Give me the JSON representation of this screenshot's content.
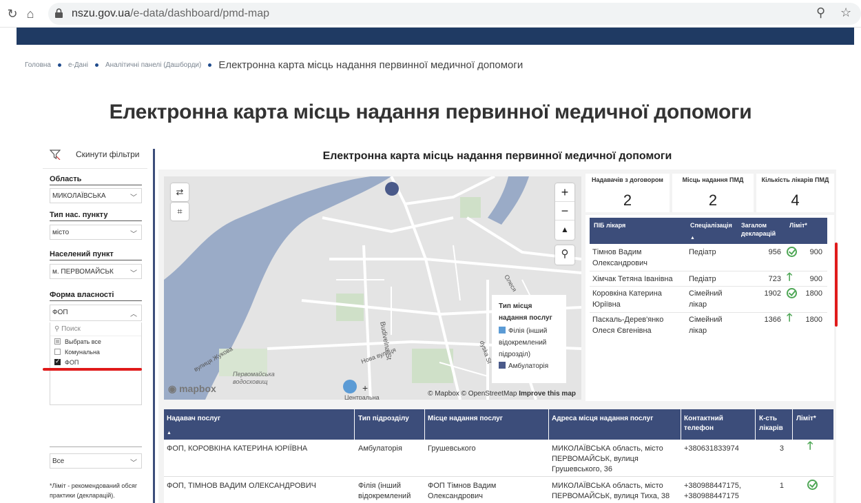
{
  "browser": {
    "url_host": "nszu.gov.ua",
    "url_path": "/e-data/dashboard/pmd-map"
  },
  "breadcrumb": [
    "Головна",
    "е-Дані",
    "Аналітичні панелі (Дашборди)",
    "Електронна карта місць надання первинної медичної допомоги"
  ],
  "page_title": "Електронна карта місць надання первинної медичної допомоги",
  "filters": {
    "reset_label": "Скинути фільтри",
    "region_label": "Область",
    "region_value": "МИКОЛАЇВСЬКА",
    "settlement_type_label": "Тип нас. пункту",
    "settlement_type_value": "місто",
    "settlement_label": "Населений пункт",
    "settlement_value": "м. ПЕРВОМАЙСЬК",
    "ownership_label": "Форма власності",
    "ownership_value": "ФОП",
    "search_placeholder": "Поиск",
    "options": [
      "Выбрать все",
      "Комунальна",
      "ФОП"
    ],
    "bottom_select_value": "Все",
    "note": "*Ліміт - рекомендований обсяг практики (декларацій)."
  },
  "report": {
    "title": "Електронна карта місць надання первинної медичної допомоги",
    "kpis": [
      {
        "label": "Надавачів з договором",
        "value": "2"
      },
      {
        "label": "Місць надання ПМД",
        "value": "2"
      },
      {
        "label": "Кількість лікарів ПМД",
        "value": "4"
      }
    ],
    "map": {
      "legend_title": "Тип місця надання послуг",
      "legend_items": [
        {
          "label": "Філія (інший відокремлений підрозділ)",
          "color": "#5b9bd5"
        },
        {
          "label": "Амбулаторія",
          "color": "#4a5a8a"
        }
      ],
      "mapbox_logo": "mapbox",
      "attribution": "© Mapbox © OpenStreetMap",
      "improve": "Improve this map",
      "labels": {
        "street1": "Budivelna St",
        "street2": "Нова вулиця",
        "street3": "вулиця Жукова",
        "district": "Первомайська водосховищ",
        "central": "Центральна",
        "olesya": "Олеся",
        "dyska": "dyska St"
      }
    },
    "doctors_table": {
      "headers": [
        "ПІБ лікаря",
        "Спеціалізація",
        "Загалом декларацій",
        "Ліміт*"
      ],
      "rows": [
        {
          "name": "Тімнов Вадим Олександрович",
          "spec": "Педіатр",
          "decl": "956",
          "status": "ok",
          "limit": "900"
        },
        {
          "name": "Хімчак Тетяна Іванівна",
          "spec": "Педіатр",
          "decl": "723",
          "status": "up",
          "limit": "900"
        },
        {
          "name": "Коровкіна Катерина Юріївна",
          "spec": "Сімейний лікар",
          "decl": "1902",
          "status": "ok",
          "limit": "1800"
        },
        {
          "name": "Паскаль-Дерев'янко Олеся Євгенівна",
          "spec": "Сімейний лікар",
          "decl": "1366",
          "status": "up",
          "limit": "1800"
        }
      ]
    },
    "providers_table": {
      "headers": [
        "Надавач послуг",
        "Тип підрозділу",
        "Місце надання послуг",
        "Адреса місця надання послуг",
        "Контактний телефон",
        "К-сть лікарів",
        "Ліміт*"
      ],
      "rows": [
        {
          "provider": "ФОП, КОРОВКІНА КАТЕРИНА ЮРІЇВНА",
          "type": "Амбулаторія",
          "place": "Грушевського",
          "address": "МИКОЛАЇВСЬКА область, місто ПЕРВОМАЙСЬК, вулиця Грушевського, 36",
          "phone": "+380631833974",
          "count": "3",
          "status": "up"
        },
        {
          "provider": "ФОП, ТІМНОВ ВАДИМ ОЛЕКСАНДРОВИЧ",
          "type": "Філія (інший відокремлений",
          "place": "ФОП Тімнов Вадим Олександрович",
          "address": "МИКОЛАЇВСЬКА область, місто ПЕРВОМАЙСЬК, вулиця Тиха, 38",
          "phone": "+380988447175, +380988447175",
          "count": "1",
          "status": "ok"
        }
      ]
    }
  }
}
